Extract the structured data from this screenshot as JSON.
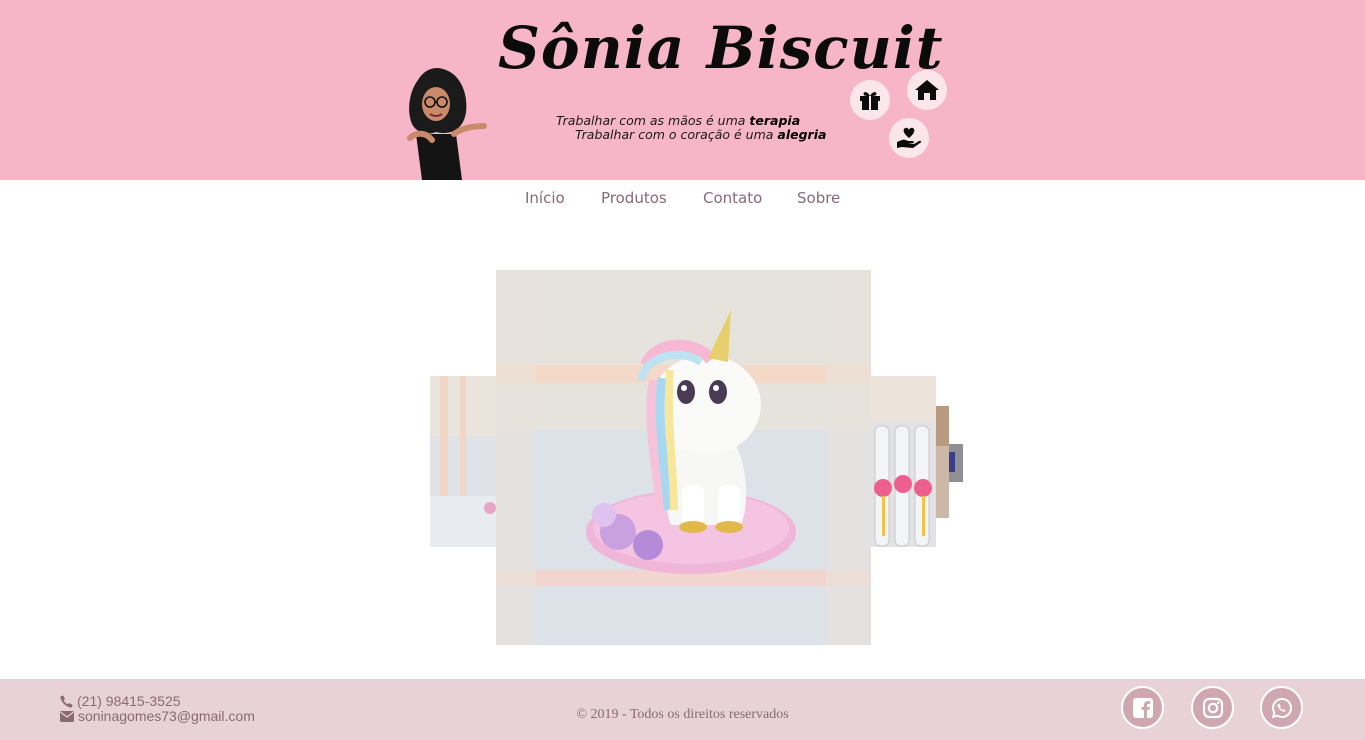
{
  "header": {
    "title": "Sônia Biscuit",
    "tagline_1_prefix": "Trabalhar com as mãos é uma ",
    "tagline_1_emphasis": "terapia",
    "tagline_2_prefix": "Trabalhar com o coração é uma ",
    "tagline_2_emphasis": "alegria",
    "icons": [
      "gift-icon",
      "home-icon",
      "hand-heart-icon"
    ]
  },
  "nav": {
    "items": [
      {
        "label": "Início"
      },
      {
        "label": "Produtos"
      },
      {
        "label": "Contato"
      },
      {
        "label": "Sobre"
      }
    ]
  },
  "carousel": {
    "slides": [
      "unicorn-biscuit",
      "pink-toy-side",
      "flamingo-tubes",
      "product-4",
      "product-5"
    ]
  },
  "footer": {
    "phone": "(21) 98415-3525",
    "email": "soninagomes73@gmail.com",
    "copyright": "© 2019 - Todos os direitos reservados",
    "social": [
      "facebook-icon",
      "instagram-icon",
      "whatsapp-icon"
    ]
  },
  "colors": {
    "header_bg": "#f7b6c7",
    "footer_bg": "#e8d2d7",
    "nav_text": "#8a6a72",
    "social_bg": "#cfa7b1"
  }
}
